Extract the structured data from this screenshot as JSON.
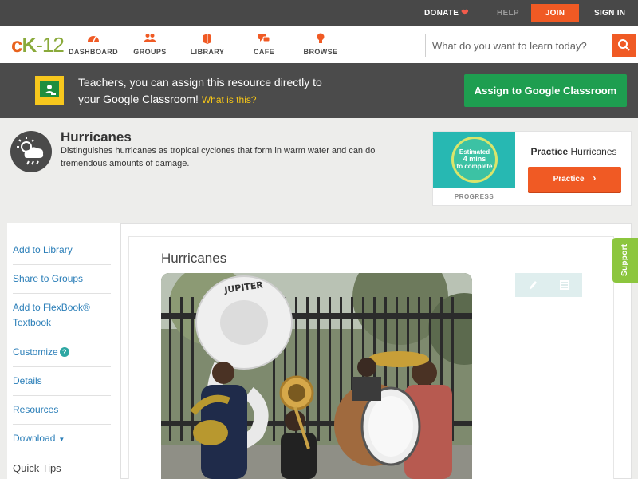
{
  "topbar": {
    "donate": "DONATE",
    "help": "HELP",
    "join": "JOIN",
    "signin": "SIGN IN",
    "accent": "#f05a24"
  },
  "nav": {
    "logo_c": "c",
    "logo_k": "K",
    "logo_n": "-12",
    "items": [
      {
        "label": "DASHBOARD",
        "icon": "dashboard-icon"
      },
      {
        "label": "GROUPS",
        "icon": "groups-icon"
      },
      {
        "label": "LIBRARY",
        "icon": "library-icon"
      },
      {
        "label": "CAFE",
        "icon": "cafe-icon"
      },
      {
        "label": "BROWSE",
        "icon": "browse-icon"
      }
    ],
    "search_placeholder": "What do you want to learn today?"
  },
  "classroom": {
    "line1": "Teachers, you can assign this resource directly to",
    "line2": "your Google Classroom!",
    "what_link": "What is this?",
    "assign_button": "Assign to Google Classroom",
    "button_color": "#1e9e50"
  },
  "concept": {
    "title": "Hurricanes",
    "description": "Distinguishes hurricanes as tropical cyclones that form in warm water and can do tremendous amounts of damage."
  },
  "practice": {
    "estimated": "Estimated",
    "mins": "4 mins",
    "to_complete": "to complete",
    "progress_label": "PROGRESS",
    "title_bold": "Practice",
    "title_rest": "Hurricanes",
    "button": "Practice"
  },
  "sidebar": {
    "items": [
      {
        "label": "Add to Library"
      },
      {
        "label": "Share to Groups"
      },
      {
        "label": "Add to FlexBook® Textbook"
      },
      {
        "label": "Customize"
      },
      {
        "label": "Details"
      },
      {
        "label": "Resources"
      },
      {
        "label": "Download"
      },
      {
        "label": "Quick Tips"
      }
    ]
  },
  "content": {
    "title": "Hurricanes",
    "photo_alt": "Brass band with sousaphone marked JUPITER"
  },
  "support": {
    "label": "Support",
    "color": "#8cc63e"
  }
}
